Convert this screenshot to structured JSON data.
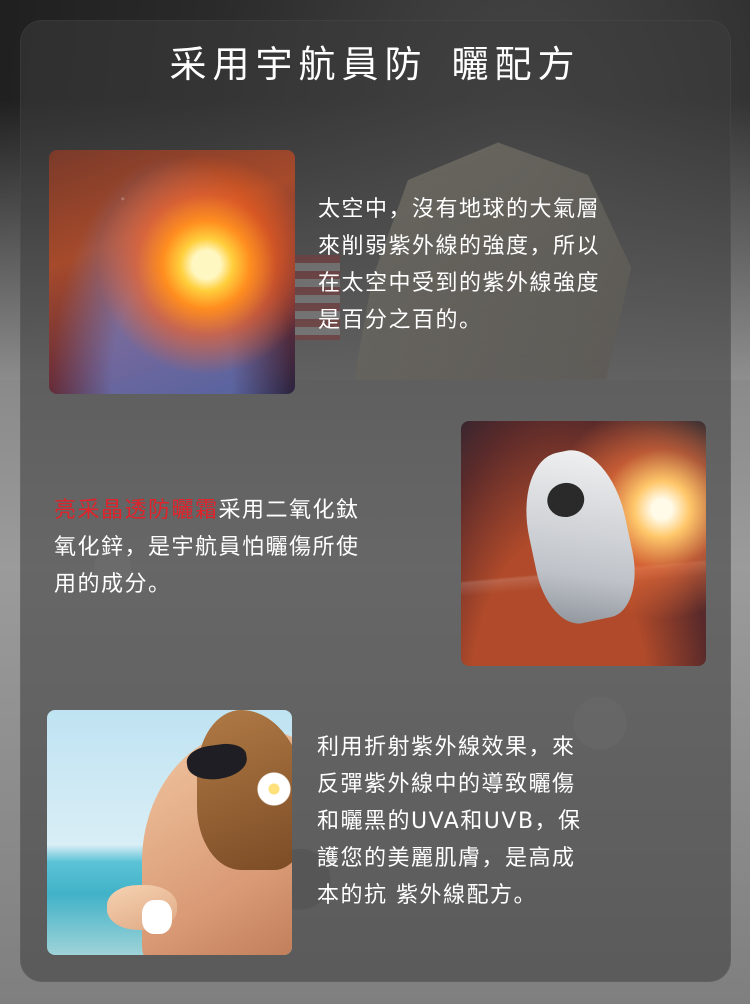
{
  "title_part1": "采用宇航員防",
  "title_part2": "曬配方",
  "section1": {
    "lines": [
      "太空中，沒有地球的大氣層",
      "來削弱紫外線的強度，所以",
      "在太空中受到的紫外線強度",
      "是百分之百的。"
    ]
  },
  "section2": {
    "highlight": "亮采晶透防曬霜",
    "line1_rest": "采用二氧化鈦",
    "lines": [
      "氧化鋅，是宇航員怕曬傷所使",
      "用的成分。"
    ]
  },
  "section3": {
    "lines": [
      "利用折射紫外線效果，來",
      "反彈紫外線中的導致曬傷",
      "和曬黑的UVA和UVB，保",
      "護您的美麗肌膚，是高成",
      "本的抗 紫外線配方。"
    ]
  },
  "colors": {
    "highlight": "#e0232a",
    "text": "#ffffff"
  }
}
